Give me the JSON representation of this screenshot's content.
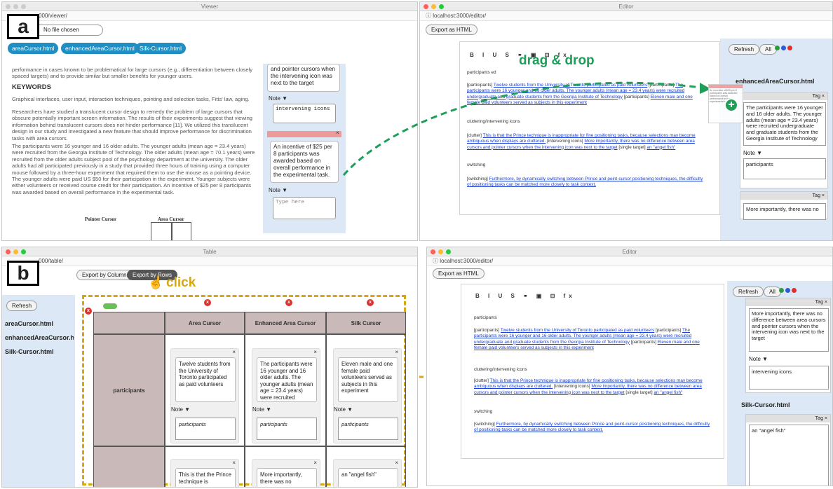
{
  "labels": {
    "a": "a",
    "b": "b"
  },
  "annotations": {
    "drag": "drag & drop",
    "click": "click"
  },
  "colors": {
    "tab": "#1f8fc3",
    "panel": "#dce8f6",
    "link": "#1b3fd1",
    "green": "#1f9e5a",
    "gold": "#d6a714",
    "red": "#e0302c",
    "cell": "#c9b9b9"
  },
  "viewer": {
    "title": "Viewer",
    "url": "000/viewer/",
    "file_button": "No file chosen",
    "tabs": [
      "areaCursor.html",
      "enhancedAreaCursor.html",
      "Silk-Cursor.html"
    ],
    "para0": "performance in cases known to be problematical for large cursors (e.g., differentiation between closely spaced targets) and to provide similar but smaller benefits for younger users.",
    "keywords_heading": "KEYWORDS",
    "keywords": "Graphical interfaces, user input, interaction techniques, pointing and selection tasks, Fitts' law, aging.",
    "para1": "Researchers have studied a translucent cursor design to remedy the problem of large cursors that obscure potentially important screen information. The results of their experiments suggest that viewing information behind translucent cursors does not hinder performance [11]. We utilized this translucent design in our study and investigated a new feature that should improve performance for discrimination tasks with area cursors.",
    "para2": "The participants were 16 younger and 16 older adults. The younger adults (mean age = 23.4 years) were recruited from the Georgia Institute of Technology. The older adults (mean age = 70.1 years) were recruited from the older adults subject pool of the psychology department at the university. The older adults had all participated previously in a study that provided three hours of training using a computer mouse followed by a three-hour experiment that required them to use the mouse as a pointing device. The younger adults were paid US $50 for their participation in the experiment. Younger subjects were either volunteers or received course credit for their participation. An incentive of $25 per 8 participants was awarded based on overall performance in the experimental task.",
    "fig_labels": [
      "Pointer Cursor",
      "Area Cursor"
    ],
    "card1_text": "and pointer cursors when the intervening icon was next to the target",
    "note_label": "Note ▼",
    "card1_note": "intervening icons",
    "card2_text": "An incentive of $25 per 8 participants was awarded based on overall performance in the experimental task.",
    "card2_placeholder": "Type here",
    "close": "×"
  },
  "editor_a": {
    "title": "Editor",
    "url": "ⓘ localhost:3000/editor/",
    "export": "Export as HTML",
    "toolbar": "B I U S  ⚭ ▣ ⊟ fx",
    "line1": "participants ed",
    "p1_tag": "[participants]",
    "p1_link1": "Twelve students from the University of Toronto participated as paid volunteers",
    "p1_tag2": "[participants]",
    "p1_link2": "The participants were 16 younger and 16 older adults. The younger adults (mean age = 23.4 years) were recruited undergraduate and graduate students from the Georgia Institute of Technology",
    "p1_tag3": "[participants]",
    "p1_link3": "Eleven male and one female paid volunteers served as subjects in this experiment",
    "h2": "cluttering/intervening icons",
    "p2_tag": "[clutter]",
    "p2_link1": "This is that the Prince technique is inappropriate for fine positioning tasks, because selections may become ambiguous when displays are cluttered.",
    "p2_tag2": "[intervening icons]",
    "p2_link2": "More importantly, there was no difference between area cursors and pointer cursors when the intervening icon was next to the target",
    "p2_tag3": "[single target]",
    "p2_link3": "an \"angel fish\"",
    "h3": "switching",
    "p3_tag": "[switching]",
    "p3_link": "Furthermore, by dynamically switching between Prince and point-cursor positioning techniques, the difficulty of positioning tasks can be matched more closely to task context.",
    "refresh": "Refresh",
    "all": "All",
    "file1": "enhancedAreaCursor.html",
    "tag": "Tag ×",
    "tag1_text": "The participants were 16 younger and 16 older adults. The younger adults (mean age = 23.4 years) were recruited undergraduate and graduate students from the Georgia Institute of Technology",
    "note_label": "Note ▼",
    "tag1_note": "participants",
    "tag2_text": "More importantly, there was no"
  },
  "table": {
    "title": "Table",
    "url": "000/table/",
    "export_cols": "Export by Columns",
    "export_rows": "Export by Rows",
    "refresh": "Refresh",
    "files": [
      "areaCursor.html",
      "enhancedAreaCursor.html",
      "Silk-Cursor.html"
    ],
    "columns": [
      "Area Cursor",
      "Enhanced Area Cursor",
      "Silk Cursor"
    ],
    "row_label": "participants",
    "cards": [
      {
        "text": "Twelve students from the University of Toronto participated as paid volunteers",
        "note": "participants"
      },
      {
        "text": "The participants were 16 younger and 16 older adults. The younger adults (mean age = 23.4 years) were recruited",
        "note": "participants"
      },
      {
        "text": "Eleven male and one female paid volunteers served as subjects in this experiment",
        "note": "participants"
      }
    ],
    "row2": [
      "This is that the Prince technique is",
      "More importantly, there was no",
      "an \"angel fish\""
    ],
    "note_label": "Note ▼",
    "close": "×",
    "x": "x"
  },
  "editor_b": {
    "title": "Editor",
    "url": "ⓘ localhost:3000/editor/",
    "export": "Export as HTML",
    "toolbar": "B I U S  ⚭ ▣ ⊟ fx",
    "h1": "participants",
    "h2": "cluttering/intervening icons",
    "h3": "switching",
    "refresh": "Refresh",
    "all": "All",
    "tag": "Tag ×",
    "tag1_text": "More importantly, there was no difference between area cursors and pointer cursors when the intervening icon was next to the target",
    "note_label": "Note ▼",
    "tag1_note": "intervening icons",
    "file2": "Silk-Cursor.html",
    "tag2_text": "an \"angel fish\""
  }
}
